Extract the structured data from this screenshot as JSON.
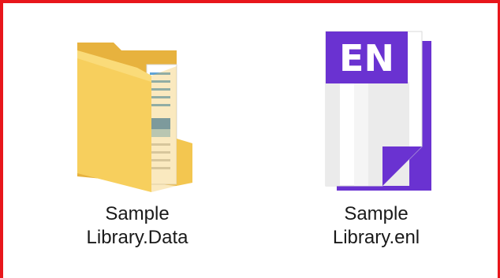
{
  "files": [
    {
      "name_line1": "Sample",
      "name_line2": "Library.Data",
      "icon": "folder-icon"
    },
    {
      "name_line1": "Sample",
      "name_line2": "Library.enl",
      "icon": "endnote-library-icon",
      "badge_text": "EN"
    }
  ],
  "colors": {
    "frame_border": "#e8161b",
    "folder_yellow": "#f5c94e",
    "endnote_purple": "#6a32d1"
  }
}
